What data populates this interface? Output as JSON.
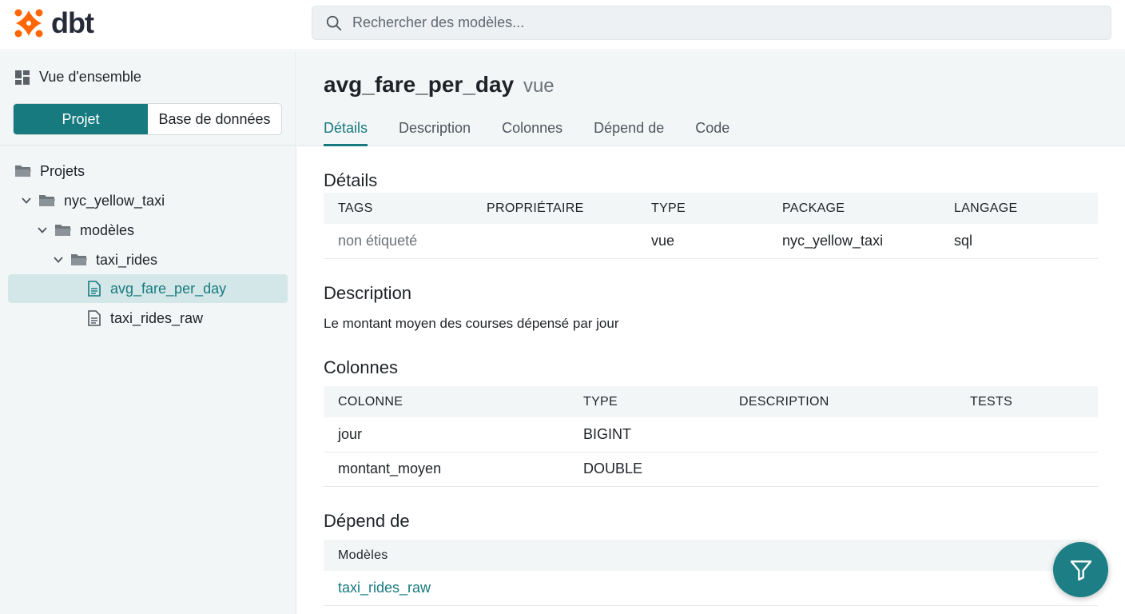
{
  "app": {
    "logo_text": "dbt",
    "brand_color": "#fe6703",
    "accent_color": "#167a7f"
  },
  "search": {
    "placeholder": "Rechercher des modèles..."
  },
  "sidebar": {
    "overview_label": "Vue d'ensemble",
    "toggle": {
      "project_label": "Projet",
      "database_label": "Base de données",
      "active": "Projet"
    },
    "tree": {
      "root": "Projets",
      "project": "nyc_yellow_taxi",
      "models_folder": "modèles",
      "subfolder": "taxi_rides",
      "files": [
        {
          "label": "avg_fare_per_day",
          "selected": true
        },
        {
          "label": "taxi_rides_raw",
          "selected": false
        }
      ]
    }
  },
  "model": {
    "name": "avg_fare_per_day",
    "type": "vue",
    "tabs": [
      "Détails",
      "Description",
      "Colonnes",
      "Dépend de",
      "Code"
    ],
    "active_tab": "Détails"
  },
  "details": {
    "title": "Détails",
    "headers": [
      "TAGS",
      "PROPRIÉTAIRE",
      "TYPE",
      "PACKAGE",
      "LANGAGE"
    ],
    "row": {
      "tags": "non étiqueté",
      "owner": "",
      "type": "vue",
      "package": "nyc_yellow_taxi",
      "language": "sql"
    }
  },
  "description": {
    "title": "Description",
    "text": "Le montant moyen des courses dépensé par jour"
  },
  "columns": {
    "title": "Colonnes",
    "headers": [
      "COLONNE",
      "TYPE",
      "DESCRIPTION",
      "TESTS"
    ],
    "rows": [
      {
        "name": "jour",
        "type": "BIGINT",
        "description": "",
        "tests": ""
      },
      {
        "name": "montant_moyen",
        "type": "DOUBLE",
        "description": "",
        "tests": ""
      }
    ]
  },
  "depends_on": {
    "title": "Dépend de",
    "header": "Modèles",
    "models": [
      "taxi_rides_raw"
    ]
  },
  "fab": {
    "icon": "filter-icon"
  }
}
